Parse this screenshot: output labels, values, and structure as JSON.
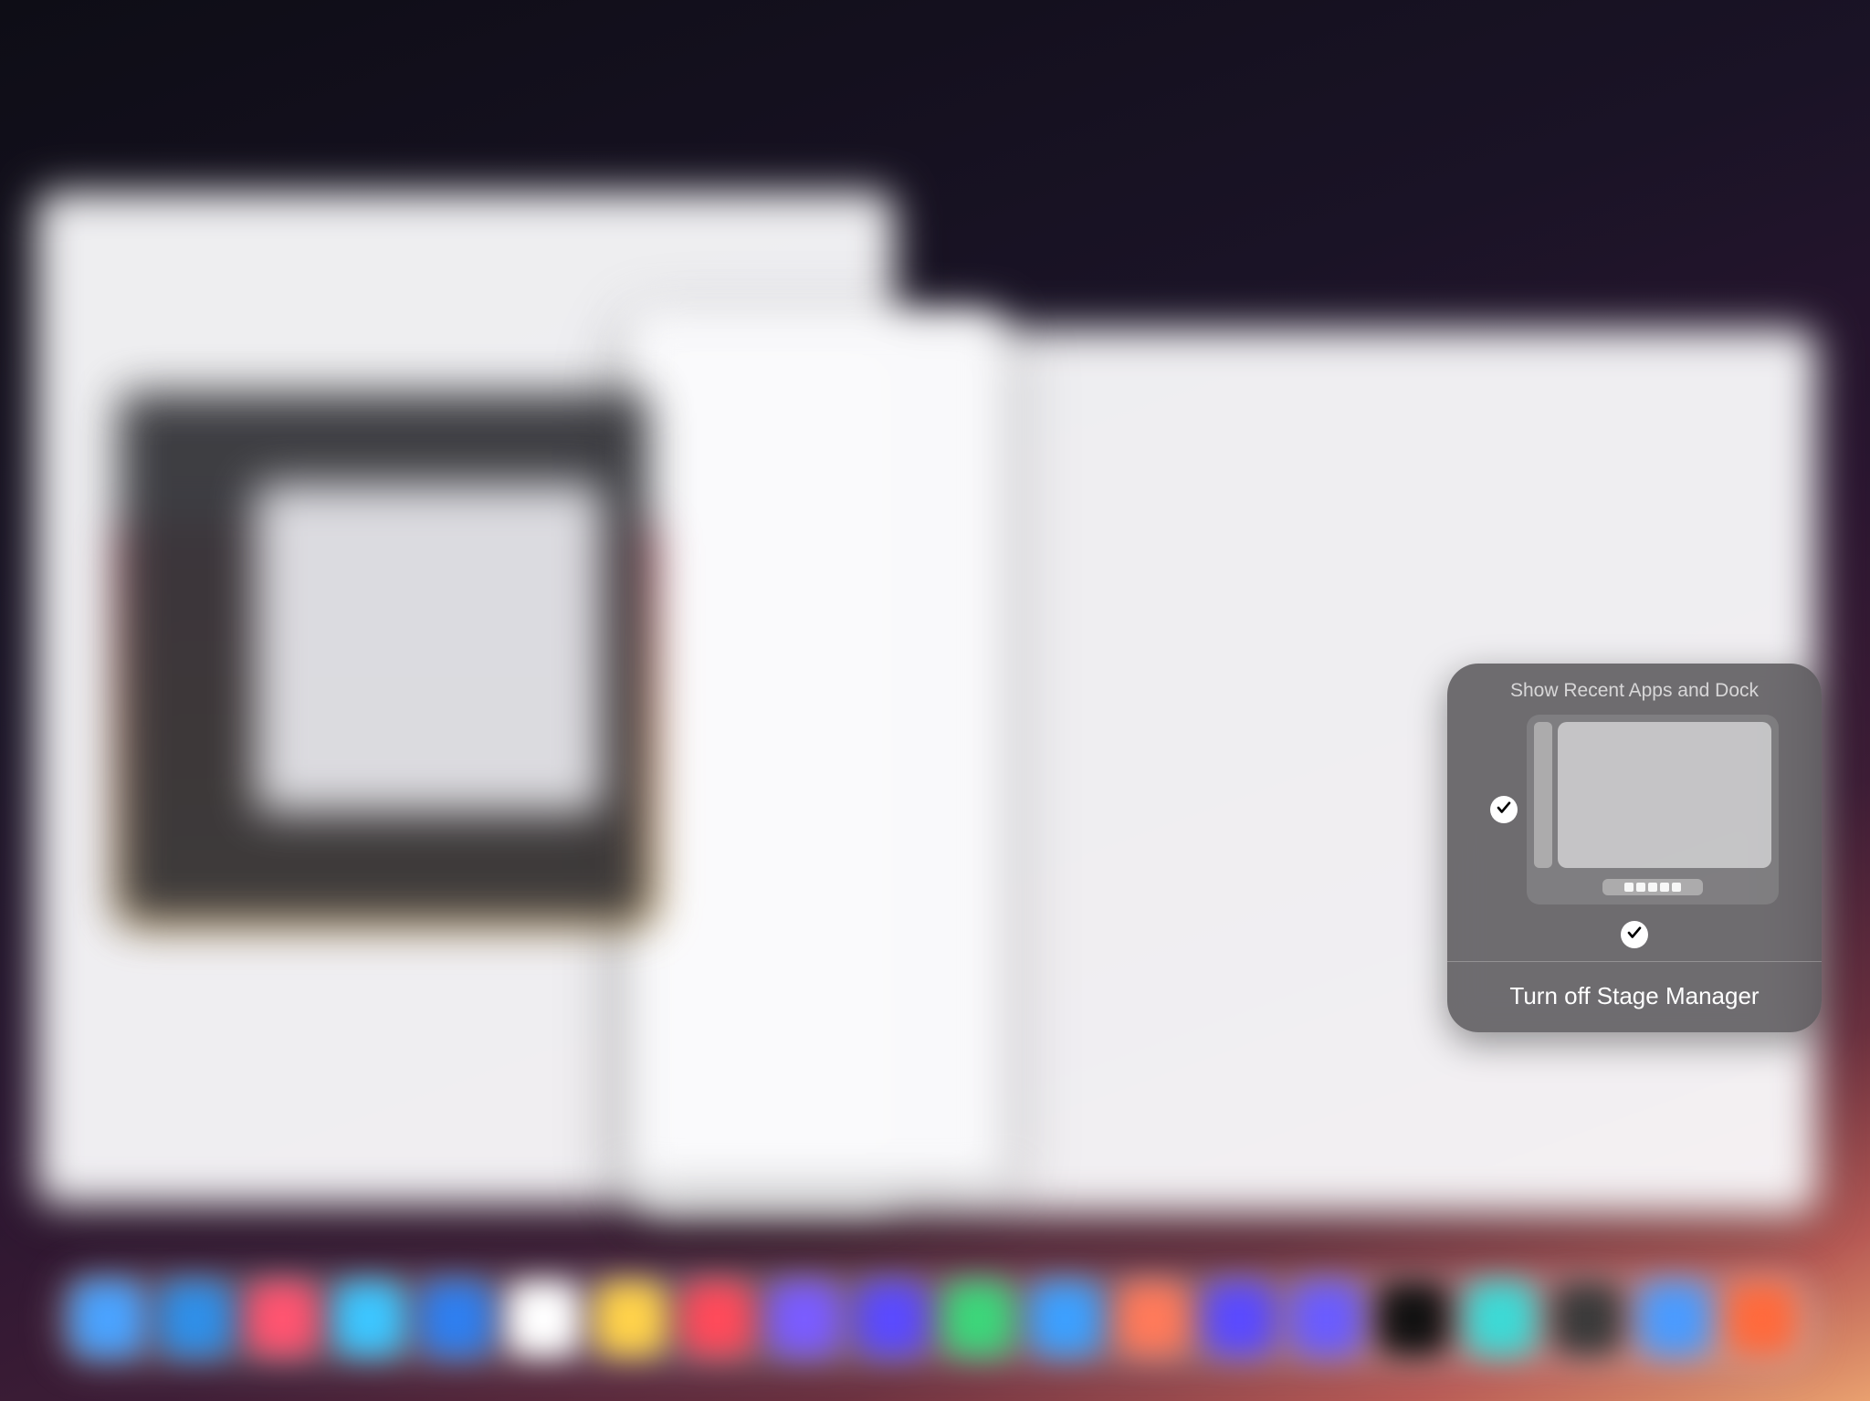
{
  "popover": {
    "title": "Show Recent Apps and Dock",
    "show_recent_apps_checked": true,
    "show_dock_checked": true,
    "action_label": "Turn off Stage Manager"
  },
  "dock_colors": [
    "#4aa3ff",
    "#2f8fe8",
    "#ff5470",
    "#3cc6ff",
    "#2e7ff0",
    "#ffffff",
    "#ffd24a",
    "#ff4a5a",
    "#7a5cff",
    "#5a4aff",
    "#3cd67a",
    "#3ca0ff",
    "#ff7a5a",
    "#5a4aff",
    "#6a5cff",
    "#111",
    "#3cdad6",
    "#3a3a3a",
    "#4a9bff",
    "#ff6a3c"
  ]
}
